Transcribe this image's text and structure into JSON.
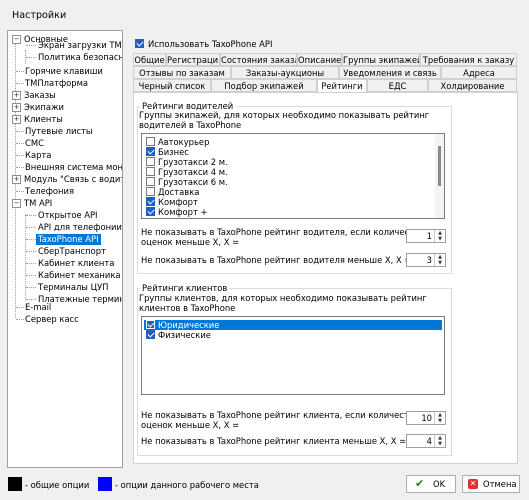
{
  "window": {
    "title": "Настройки"
  },
  "tree": {
    "nodes": [
      "Основные",
      "Экран загрузки ТМ",
      "Политика безопасност",
      "Горячие клавиши",
      "ТМПлатформа",
      "Заказы",
      "Экипажи",
      "Клиенты",
      "Путевые листы",
      "СМС",
      "Карта",
      "Внешняя система мониторинга",
      "Модуль \"Связь с водителем\"",
      "Телефония",
      "ТМ API",
      "Открытое API",
      "API для телефонии",
      "TaxoPhone API",
      "СберТранспорт",
      "Кабинет клиента",
      "Кабинет механика",
      "Терминалы ЦУП",
      "Платежные терминалы",
      "E-mail",
      "Сервер касс"
    ]
  },
  "use_api": {
    "label": "Использовать TaxoPhone API",
    "checked": true
  },
  "tabs": {
    "row1": [
      "Общие",
      "Регистрация",
      "Состояния заказа",
      "Описание",
      "Группы экипажей",
      "Требования к заказу"
    ],
    "row2": [
      "Отзывы по заказам",
      "Заказы-аукционы",
      "Уведомления и связь",
      "Адреса"
    ],
    "row3": [
      "Черный список",
      "Подбор экипажей",
      "Рейтинги",
      "ЕДС",
      "Холдирование"
    ]
  },
  "drivers": {
    "title": "Рейтинги водителей",
    "desc": "Группы экипажей, для которых необходимо показывать рейтинг водителей в TaxoPhone",
    "items": [
      {
        "label": "Автокурьер",
        "checked": false
      },
      {
        "label": "Бизнес",
        "checked": true
      },
      {
        "label": "Грузотакси 2 м.",
        "checked": false
      },
      {
        "label": "Грузотакси 4 м.",
        "checked": false
      },
      {
        "label": "Грузотакси 6 м.",
        "checked": false
      },
      {
        "label": "Доставка",
        "checked": false
      },
      {
        "label": "Комфорт",
        "checked": true
      },
      {
        "label": "Комфорт +",
        "checked": true
      }
    ],
    "count_label_1": "Не показывать в TaxoPhone рейтинг водителя, если количество",
    "count_label_2": "оценок меньше X, X =",
    "count_value": "1",
    "min_label": "Не показывать в TaxoPhone рейтинг водителя меньше X, X =",
    "min_value": "3"
  },
  "clients": {
    "title": "Рейтинги клиентов",
    "desc": "Группы клиентов, для которых необходимо показывать рейтинг клиентов в TaxoPhone",
    "items": [
      {
        "label": "Юридические",
        "checked": true
      },
      {
        "label": "Физические",
        "checked": true
      }
    ],
    "count_label_1": "Не показывать в TaxoPhone рейтинг клиента, если количество",
    "count_label_2": "оценок меньше X, X =",
    "count_value": "10",
    "min_label": "Не показывать в TaxoPhone рейтинг клиента меньше X, X =",
    "min_value": "4"
  },
  "legend": {
    "common": "- общие опции",
    "local": "- опции данного рабочего места",
    "common_color": "#000000",
    "local_color": "#0000ff"
  },
  "buttons": {
    "ok": "OK",
    "cancel": "Отмена"
  }
}
